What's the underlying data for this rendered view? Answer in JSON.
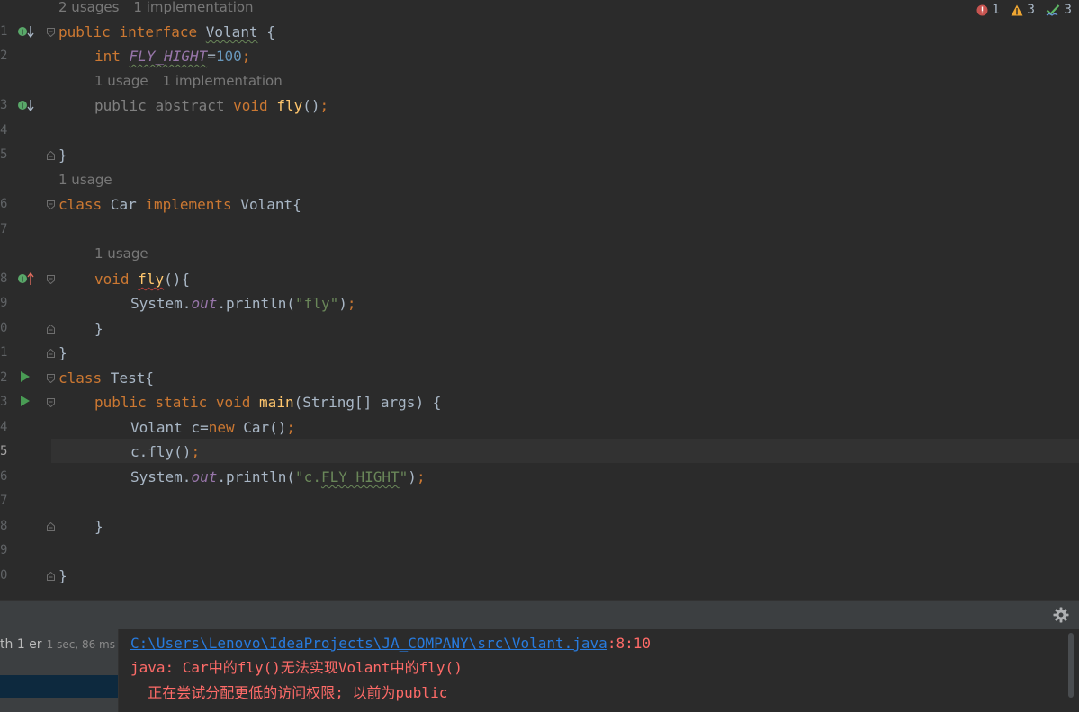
{
  "editor": {
    "status": {
      "errors": "1",
      "warnings": "3",
      "weak_warnings": "3"
    },
    "hints": {
      "h1_usages": "2 usages",
      "h1_impl": "1 implementation",
      "h2_usage": "1 usage",
      "h2_impl": "1 implementation",
      "h3_usage": "1 usage",
      "h4_usage": "1 usage"
    },
    "gutter": [
      "1",
      "2",
      "3",
      "4",
      "5",
      "6",
      "7",
      "8",
      "9",
      "0",
      "1",
      "2",
      "3",
      "4",
      "5",
      "6",
      "7",
      "8",
      "9",
      "0"
    ],
    "code": {
      "l1_kw1": "public",
      "l1_kw2": "interface",
      "l1_name": "Volant",
      "l1_rest": " {",
      "l2_kw": "int",
      "l2_const": "FLY_HIGHT",
      "l2_eq": "=",
      "l2_num": "100",
      "l2_semi": ";",
      "l3_kw1": "public",
      "l3_kw2": "abstract",
      "l3_kw3": "void",
      "l3_fn": "fly",
      "l3_paren": "()",
      "l3_semi": ";",
      "l5_brace": "}",
      "l6_kw1": "class",
      "l6_name": " Car ",
      "l6_kw2": "implements",
      "l6_rest": " Volant{",
      "l8_kw": "void",
      "l8_fn": "fly",
      "l8_rest": "(){",
      "l9_sys": "System.",
      "l9_out": "out",
      "l9_call": ".println(",
      "l9_str": "\"fly\"",
      "l9_close": ")",
      "l9_semi": ";",
      "l10_brace": "}",
      "l11_brace": "}",
      "l12_kw": "class",
      "l12_rest": " Test{",
      "l13_kw1": "public",
      "l13_kw2": "static",
      "l13_kw3": "void",
      "l13_fn": "main",
      "l13_rest": "(String[] args) {",
      "l14_type": "Volant c=",
      "l14_kw": "new",
      "l14_rest": " Car()",
      "l14_semi": ";",
      "l15_call": "c.fly()",
      "l15_semi": ";",
      "l16_sys": "System.",
      "l16_out": "out",
      "l16_call": ".println(",
      "l16_str_a": "\"c.",
      "l16_str_b": "FLY_HIGHT",
      "l16_str_c": "\"",
      "l16_close": ")",
      "l16_semi": ";",
      "l18_brace": "}",
      "l20_brace": "}"
    }
  },
  "build": {
    "left_row_label": "th 1 er",
    "left_row_time": "1 sec, 86 ms",
    "output": {
      "path": "C:\\Users\\Lenovo\\IdeaProjects\\JA_COMPANY\\src\\Volant.java",
      "position": ":8:10",
      "error_line": "java: Car中的fly()无法实现Volant中的fly()",
      "detail_line": "  正在尝试分配更低的访问权限; 以前为public"
    }
  },
  "colors": {
    "editor_bg": "#2b2b2b",
    "keyword": "#cc7832",
    "function": "#ffc66d",
    "string": "#6a8759",
    "number": "#6897bb",
    "error_text": "#ff6b68",
    "link": "#287bde"
  }
}
